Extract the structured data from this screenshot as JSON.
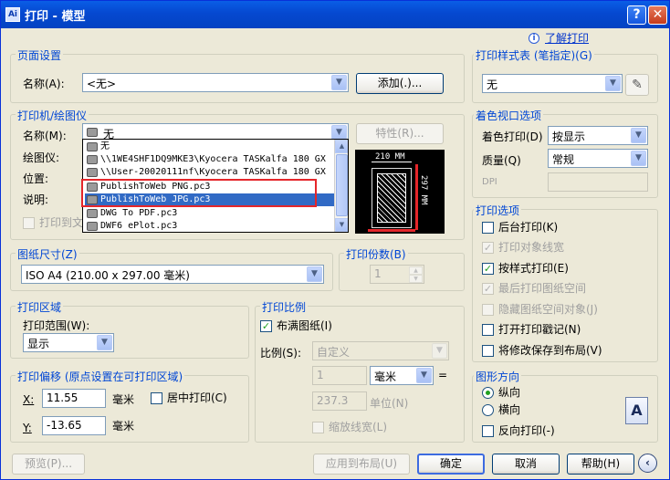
{
  "window": {
    "title": "打印 - 模型",
    "app_icon": "Ai",
    "help_button": "?",
    "close_button": "✕"
  },
  "help_link": "了解打印",
  "page_setup": {
    "group_label": "页面设置",
    "name_label": "名称(A):",
    "name_value": "<无>",
    "add_button": "添加(.)..."
  },
  "printer": {
    "group_label": "打印机/绘图仪",
    "name_label": "名称(M):",
    "name_value": "无",
    "properties_button": "特性(R)...",
    "plotter_label": "绘图仪:",
    "location_label": "位置:",
    "description_label": "说明:",
    "print_to_file_label": "打印到文件",
    "dropdown_options": [
      "无",
      "\\\\1WE4SHF1DQ9MKE3\\Kyocera TASKalfa 180 GX",
      "\\\\User-20020111nf\\Kyocera TASKalfa 180 GX",
      "PublishToWeb PNG.pc3",
      "PublishToWeb JPG.pc3",
      "DWG To PDF.pc3",
      "DWF6 ePlot.pc3"
    ],
    "selected_option_index": 4,
    "preview": {
      "width_label": "210 MM",
      "height_label": "297 MM"
    }
  },
  "paper_size": {
    "group_label": "图纸尺寸(Z)",
    "value": "ISO A4 (210.00 x 297.00 毫米)"
  },
  "copies": {
    "group_label": "打印份数(B)",
    "value": "1"
  },
  "plot_area": {
    "group_label": "打印区域",
    "range_label": "打印范围(W):",
    "range_value": "显示"
  },
  "plot_scale": {
    "group_label": "打印比例",
    "fit_to_paper_label": "布满图纸(I)",
    "fit_to_paper_checked": true,
    "scale_label": "比例(S):",
    "scale_value": "自定义",
    "scale_numerator": "1",
    "unit_value": "毫米",
    "equals": "=",
    "scale_denominator": "237.3",
    "unit_label": "单位(N)",
    "scale_lineweights_label": "缩放线宽(L)"
  },
  "plot_offset": {
    "group_label": "打印偏移 (原点设置在可打印区域)",
    "x_label": "X:",
    "x_value": "11.55",
    "x_unit": "毫米",
    "center_label": "居中打印(C)",
    "y_label": "Y:",
    "y_value": "-13.65",
    "y_unit": "毫米"
  },
  "style_table": {
    "group_label": "打印样式表 (笔指定)(G)",
    "value": "无"
  },
  "shaded_viewport": {
    "group_label": "着色视口选项",
    "shade_label": "着色打印(D)",
    "shade_value": "按显示",
    "quality_label": "质量(Q)",
    "quality_value": "常规",
    "dpi_label": "DPI"
  },
  "plot_options": {
    "group_label": "打印选项",
    "items": [
      {
        "label": "后台打印(K)",
        "checked": false,
        "enabled": true
      },
      {
        "label": "打印对象线宽",
        "checked": true,
        "enabled": false
      },
      {
        "label": "按样式打印(E)",
        "checked": true,
        "enabled": true
      },
      {
        "label": "最后打印图纸空间",
        "checked": true,
        "enabled": false
      },
      {
        "label": "隐藏图纸空间对象(J)",
        "checked": false,
        "enabled": false
      },
      {
        "label": "打开打印戳记(N)",
        "checked": false,
        "enabled": true
      },
      {
        "label": "将修改保存到布局(V)",
        "checked": false,
        "enabled": true
      }
    ]
  },
  "orientation": {
    "group_label": "图形方向",
    "portrait_label": "纵向",
    "landscape_label": "横向",
    "selected": "portrait",
    "upside_down_label": "反向打印(-)",
    "icon_letter": "A"
  },
  "footer": {
    "preview_button": "预览(P)...",
    "apply_layout_button": "应用到布局(U)",
    "ok_button": "确定",
    "cancel_button": "取消",
    "help_button": "帮助(H)",
    "collapse_icon": "‹"
  }
}
